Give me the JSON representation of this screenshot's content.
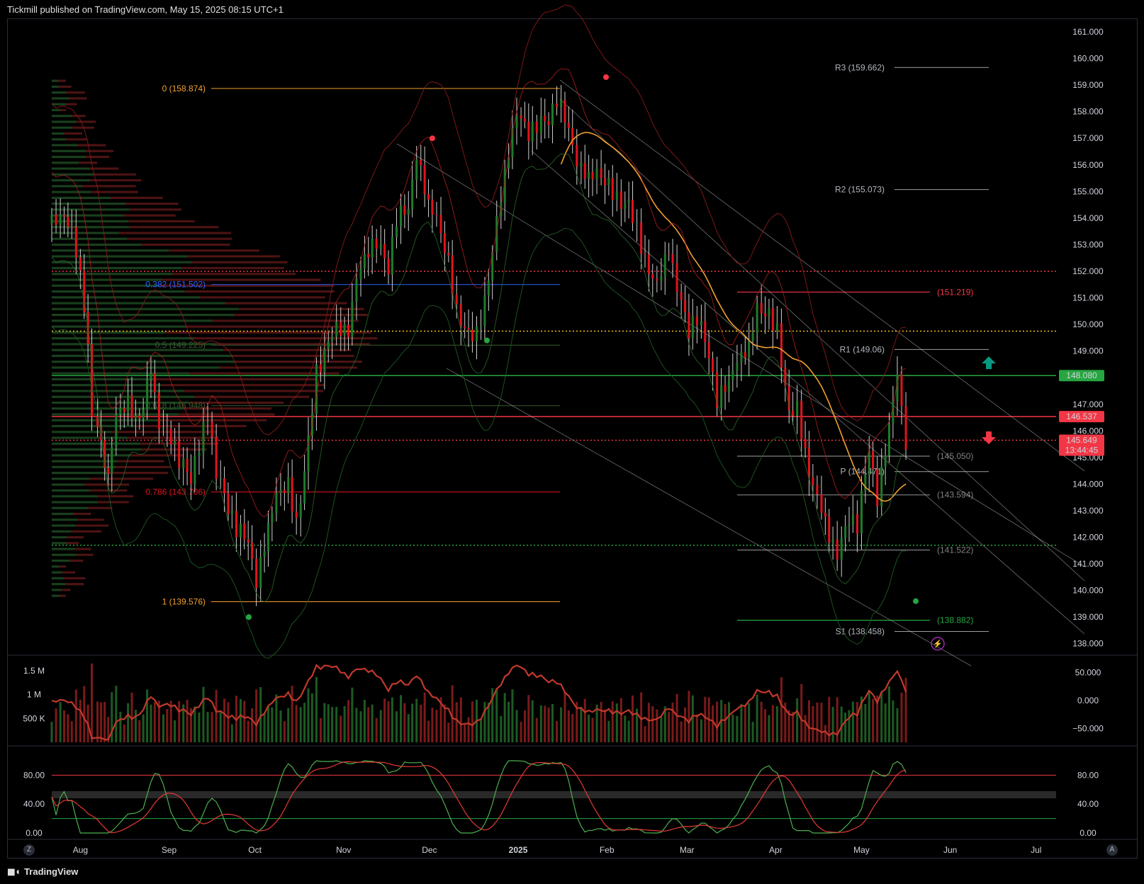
{
  "header": {
    "text": "Tickmill published on TradingView.com, May 15, 2025 08:15 UTC+1"
  },
  "footer": {
    "brand": "TradingView",
    "logo": "tv-logo-icon"
  },
  "buttons": {
    "zoom_label": "Z",
    "auto_label": "A"
  },
  "colors": {
    "up": "#1f7a2a",
    "down": "#e0141e",
    "fib": "#f0a030",
    "bg": "#000000",
    "axis_text": "#d1d4dc"
  },
  "chart_data": [
    {
      "type": "candlestick",
      "title": "",
      "price_axis": {
        "ticks": [
          "161.000",
          "160.000",
          "159.000",
          "158.000",
          "157.000",
          "156.000",
          "155.000",
          "154.000",
          "153.000",
          "152.000",
          "151.000",
          "150.000",
          "149.000",
          "148.000",
          "147.000",
          "146.000",
          "145.000",
          "144.000",
          "143.000",
          "142.000",
          "141.000",
          "140.000",
          "139.000",
          "138.000"
        ],
        "ylim": [
          137.7,
          161.4
        ]
      },
      "x_axis": {
        "ticks": [
          "Aug",
          "Sep",
          "Oct",
          "Nov",
          "Dec",
          "2025",
          "Feb",
          "Mar",
          "Apr",
          "May",
          "Jun",
          "Jul"
        ],
        "tick_dates": [
          "2024-08-01",
          "2024-09-01",
          "2024-10-01",
          "2024-11-01",
          "2024-12-01",
          "2025-01-01",
          "2025-02-01",
          "2025-03-01",
          "2025-04-01",
          "2025-05-01",
          "2025-06-01",
          "2025-07-01"
        ],
        "start_date": "2024-07-22",
        "end_date": "2025-07-08"
      },
      "price_badges": [
        {
          "value": "148.080",
          "color": "#26a641"
        },
        {
          "value": "146.537",
          "color": "#f23645"
        },
        {
          "value": "145.649",
          "sub": "13:44:45",
          "color": "#f23645"
        }
      ],
      "fibonacci": [
        {
          "label": "0 (158.874)",
          "price": 158.874,
          "color": "#f0a030"
        },
        {
          "label": "0.382 (151.502)",
          "price": 151.502,
          "color": "#2962ff"
        },
        {
          "label": "0.5 (149.225)",
          "price": 149.225,
          "color": "#3a5a30"
        },
        {
          "label": "0.618 (146.948)",
          "price": 146.948,
          "color": "#3a5a30"
        },
        {
          "label": "0.786 (143.706)",
          "price": 143.706,
          "color": "#e0141e"
        },
        {
          "label": "1 (139.576)",
          "price": 139.576,
          "color": "#f0a030"
        }
      ],
      "pivots": [
        {
          "label": "R3 (159.662)",
          "price": 159.662
        },
        {
          "label": "R2 (155.073)",
          "price": 155.073
        },
        {
          "label": "R1 (149.06)",
          "price": 149.06
        },
        {
          "label": "P (144.471)",
          "price": 144.471
        },
        {
          "label": "S1 (138.458)",
          "price": 138.458
        }
      ],
      "right_levels": [
        {
          "label": "(151.219)",
          "price": 151.219,
          "color": "#f23645"
        },
        {
          "label": "(145.050)",
          "price": 145.05,
          "color": "#808080"
        },
        {
          "label": "(143.594)",
          "price": 143.594,
          "color": "#808080"
        },
        {
          "label": "(141.522)",
          "price": 141.522,
          "color": "#808080"
        },
        {
          "label": "(138.882)",
          "price": 138.882,
          "color": "#26a641"
        }
      ],
      "horizontal_lines": [
        {
          "price": 148.08,
          "color": "#26a641",
          "style": "solid"
        },
        {
          "price": 146.537,
          "color": "#f23645",
          "style": "solid"
        },
        {
          "price": 145.649,
          "color": "#f23645",
          "style": "dotted"
        },
        {
          "price": 152.0,
          "color": "#f23645",
          "style": "dotted"
        },
        {
          "price": 149.75,
          "color": "#f0c020",
          "style": "dotted"
        },
        {
          "price": 141.7,
          "color": "#26a641",
          "style": "dotted"
        }
      ],
      "close_series": [
        {
          "d": "2024-07-22",
          "c": 153.8
        },
        {
          "d": "2024-07-25",
          "c": 154.0
        },
        {
          "d": "2024-07-29",
          "c": 152.8
        },
        {
          "d": "2024-08-01",
          "c": 149.5
        },
        {
          "d": "2024-08-05",
          "c": 146.5
        },
        {
          "d": "2024-08-07",
          "c": 144.4
        },
        {
          "d": "2024-08-12",
          "c": 146.8
        },
        {
          "d": "2024-08-15",
          "c": 147.1
        },
        {
          "d": "2024-08-19",
          "c": 146.2
        },
        {
          "d": "2024-08-23",
          "c": 148.3
        },
        {
          "d": "2024-08-27",
          "c": 146.0
        },
        {
          "d": "2024-08-30",
          "c": 145.8
        },
        {
          "d": "2024-09-03",
          "c": 144.8
        },
        {
          "d": "2024-09-06",
          "c": 144.3
        },
        {
          "d": "2024-09-10",
          "c": 145.5
        },
        {
          "d": "2024-09-13",
          "c": 146.6
        },
        {
          "d": "2024-09-16",
          "c": 144.3
        },
        {
          "d": "2024-09-19",
          "c": 143.2
        },
        {
          "d": "2024-09-23",
          "c": 142.3
        },
        {
          "d": "2024-09-26",
          "c": 142.0
        },
        {
          "d": "2024-09-30",
          "c": 140.4
        },
        {
          "d": "2024-10-03",
          "c": 142.5
        },
        {
          "d": "2024-10-07",
          "c": 143.8
        },
        {
          "d": "2024-10-10",
          "c": 144.0
        },
        {
          "d": "2024-10-14",
          "c": 142.6
        },
        {
          "d": "2024-10-17",
          "c": 145.5
        },
        {
          "d": "2024-10-21",
          "c": 148.2
        },
        {
          "d": "2024-10-24",
          "c": 149.2
        },
        {
          "d": "2024-10-28",
          "c": 149.8
        },
        {
          "d": "2024-10-31",
          "c": 149.6
        },
        {
          "d": "2024-11-04",
          "c": 151.6
        },
        {
          "d": "2024-11-07",
          "c": 152.8
        },
        {
          "d": "2024-11-11",
          "c": 153.0
        },
        {
          "d": "2024-11-14",
          "c": 152.2
        },
        {
          "d": "2024-11-18",
          "c": 154.0
        },
        {
          "d": "2024-11-21",
          "c": 154.5
        },
        {
          "d": "2024-11-25",
          "c": 156.5
        },
        {
          "d": "2024-11-28",
          "c": 154.6
        },
        {
          "d": "2024-12-02",
          "c": 154.2
        },
        {
          "d": "2024-12-05",
          "c": 152.3
        },
        {
          "d": "2024-12-09",
          "c": 150.6
        },
        {
          "d": "2024-12-12",
          "c": 149.5
        },
        {
          "d": "2024-12-16",
          "c": 149.6
        },
        {
          "d": "2024-12-19",
          "c": 151.5
        },
        {
          "d": "2024-12-23",
          "c": 153.8
        },
        {
          "d": "2024-12-26",
          "c": 156.4
        },
        {
          "d": "2024-12-30",
          "c": 157.8
        },
        {
          "d": "2025-01-02",
          "c": 157.2
        },
        {
          "d": "2025-01-06",
          "c": 157.4
        },
        {
          "d": "2025-01-09",
          "c": 157.8
        },
        {
          "d": "2025-01-13",
          "c": 158.5
        },
        {
          "d": "2025-01-16",
          "c": 157.5
        },
        {
          "d": "2025-01-20",
          "c": 156.2
        },
        {
          "d": "2025-01-23",
          "c": 155.6
        },
        {
          "d": "2025-01-27",
          "c": 155.9
        },
        {
          "d": "2025-01-30",
          "c": 155.2
        },
        {
          "d": "2025-02-03",
          "c": 154.8
        },
        {
          "d": "2025-02-06",
          "c": 154.4
        },
        {
          "d": "2025-02-10",
          "c": 153.5
        },
        {
          "d": "2025-02-13",
          "c": 151.8
        },
        {
          "d": "2025-02-17",
          "c": 151.4
        },
        {
          "d": "2025-02-20",
          "c": 152.8
        },
        {
          "d": "2025-02-24",
          "c": 151.2
        },
        {
          "d": "2025-02-27",
          "c": 149.8
        },
        {
          "d": "2025-03-03",
          "c": 150.2
        },
        {
          "d": "2025-03-06",
          "c": 149.0
        },
        {
          "d": "2025-03-10",
          "c": 147.2
        },
        {
          "d": "2025-03-13",
          "c": 148.0
        },
        {
          "d": "2025-03-17",
          "c": 148.8
        },
        {
          "d": "2025-03-20",
          "c": 149.2
        },
        {
          "d": "2025-03-24",
          "c": 150.8
        },
        {
          "d": "2025-03-27",
          "c": 150.3
        },
        {
          "d": "2025-03-31",
          "c": 149.8
        },
        {
          "d": "2025-04-03",
          "c": 146.5
        },
        {
          "d": "2025-04-07",
          "c": 146.8
        },
        {
          "d": "2025-04-10",
          "c": 144.2
        },
        {
          "d": "2025-04-14",
          "c": 143.4
        },
        {
          "d": "2025-04-17",
          "c": 142.0
        },
        {
          "d": "2025-04-21",
          "c": 141.2
        },
        {
          "d": "2025-04-24",
          "c": 142.8
        },
        {
          "d": "2025-04-28",
          "c": 142.4
        },
        {
          "d": "2025-05-01",
          "c": 145.5
        },
        {
          "d": "2025-05-05",
          "c": 143.5
        },
        {
          "d": "2025-05-08",
          "c": 146.3
        },
        {
          "d": "2025-05-12",
          "c": 148.3
        },
        {
          "d": "2025-05-15",
          "c": 145.6
        }
      ]
    },
    {
      "type": "bar",
      "title": "",
      "left_ticks": [
        "1.5 M",
        "1 M",
        "500 K"
      ],
      "right_ticks": [
        "50.000",
        "0.000",
        "−50.000"
      ]
    },
    {
      "type": "line",
      "title": "",
      "left_ticks": [
        "80.00",
        "40.00",
        "0.00"
      ],
      "right_ticks": [
        "80.00",
        "40.00",
        "0.00"
      ],
      "levels": [
        80,
        20
      ]
    }
  ]
}
